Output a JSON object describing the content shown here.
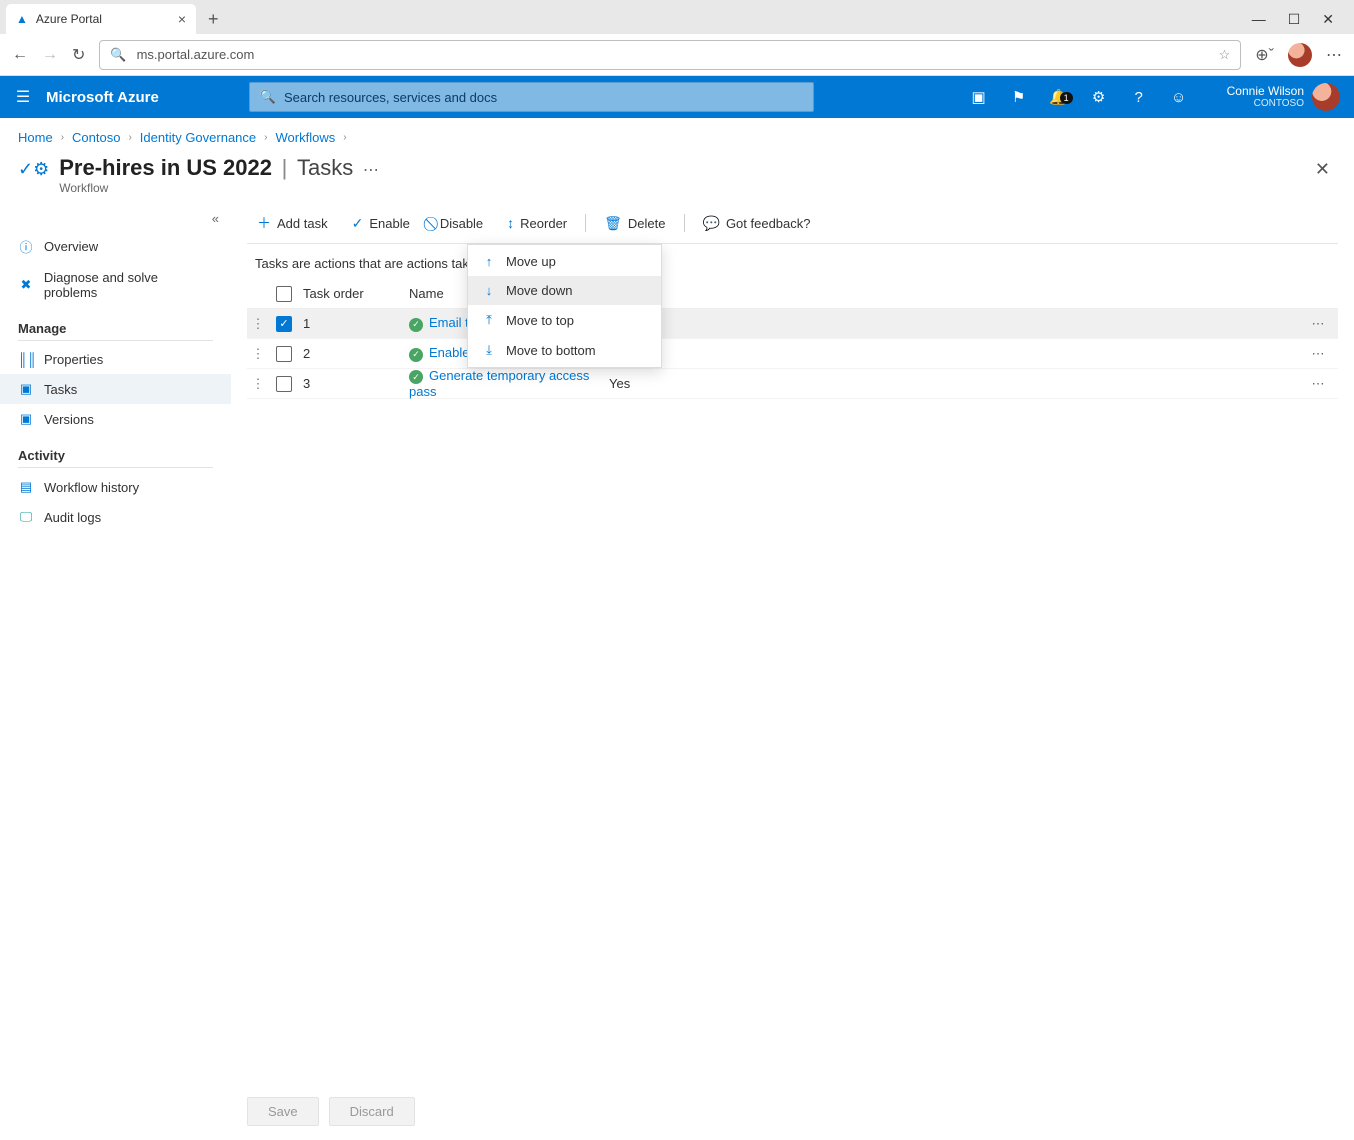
{
  "browser": {
    "tab_title": "Azure Portal",
    "url": "ms.portal.azure.com"
  },
  "azure": {
    "brand": "Microsoft Azure",
    "search_placeholder": "Search resources, services and docs",
    "notification_badge": "1",
    "user_name": "Connie Wilson",
    "tenant": "CONTOSO"
  },
  "breadcrumbs": [
    "Home",
    "Contoso",
    "Identity Governance",
    "Workflows"
  ],
  "page": {
    "title": "Pre-hires in US 2022",
    "subtitle": "Workflow",
    "section": "Tasks"
  },
  "sidebar": {
    "overview": "Overview",
    "diagnose": "Diagnose and solve problems",
    "group_manage": "Manage",
    "properties": "Properties",
    "tasks": "Tasks",
    "versions": "Versions",
    "group_activity": "Activity",
    "history": "Workflow history",
    "audit": "Audit logs"
  },
  "toolbar": {
    "add_task": "Add task",
    "enable": "Enable",
    "disable": "Disable",
    "reorder": "Reorder",
    "delete": "Delete",
    "feedback": "Got feedback?"
  },
  "reorder_menu": {
    "move_up": "Move up",
    "move_down": "Move down",
    "move_top": "Move to top",
    "move_bottom": "Move to bottom"
  },
  "help_text": "Tasks are actions that are actions taken on",
  "columns": {
    "task_order": "Task order",
    "name": "Name"
  },
  "rows": [
    {
      "order": "1",
      "name_visible": "Email to h",
      "selected": true
    },
    {
      "order": "2",
      "name_visible": "Enable us",
      "selected": false
    },
    {
      "order": "3",
      "name_visible": "Generate temporary access pass",
      "col3": "Yes",
      "selected": false
    }
  ],
  "footer": {
    "save": "Save",
    "discard": "Discard"
  }
}
